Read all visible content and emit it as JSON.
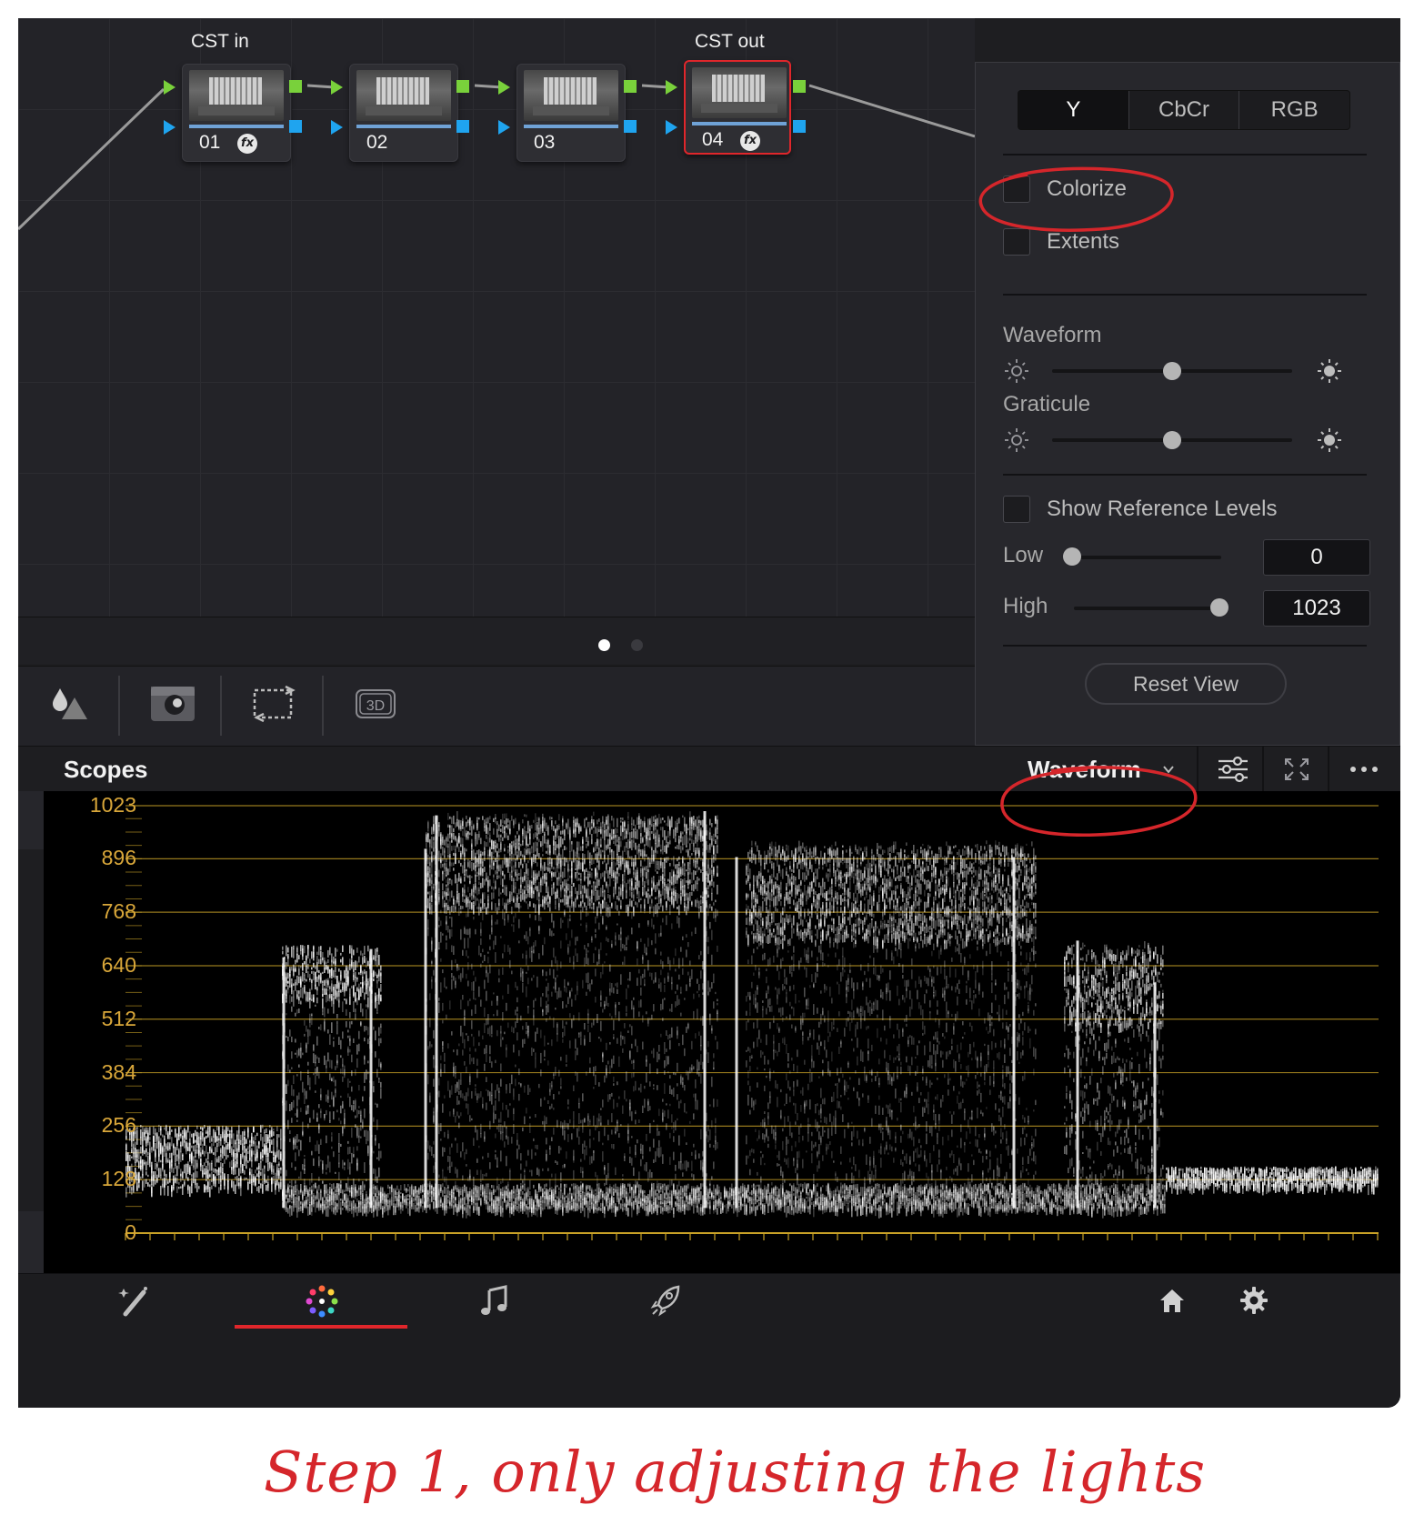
{
  "node_graph": {
    "labels": {
      "cst_in": "CST in",
      "cst_out": "CST out"
    },
    "nodes": [
      {
        "number": "01",
        "fx": true,
        "selected": false
      },
      {
        "number": "02",
        "fx": false,
        "selected": false
      },
      {
        "number": "03",
        "fx": false,
        "selected": false
      },
      {
        "number": "04",
        "fx": true,
        "selected": true
      }
    ],
    "fx_glyph": "fx",
    "page_index": {
      "current": 1,
      "total": 2
    }
  },
  "toolbar": {
    "icons": [
      "color-correction-icon",
      "key-mask-icon",
      "transform-icon",
      "3d-icon"
    ],
    "three_d_label": "3D"
  },
  "scope_settings": {
    "mode_tabs": [
      "Y",
      "CbCr",
      "RGB"
    ],
    "active_mode": "Y",
    "colorize_label": "Colorize",
    "colorize_checked": false,
    "extents_label": "Extents",
    "extents_checked": false,
    "waveform_label": "Waveform",
    "waveform_brightness": 0.5,
    "graticule_label": "Graticule",
    "graticule_brightness": 0.5,
    "show_reference_label": "Show Reference Levels",
    "show_reference_checked": false,
    "low_label": "Low",
    "low_value": "0",
    "high_label": "High",
    "high_value": "1023",
    "reset_label": "Reset View"
  },
  "scopes": {
    "title": "Scopes",
    "scope_type": "Waveform",
    "y_ticks": [
      "1023",
      "896",
      "768",
      "640",
      "512",
      "384",
      "256",
      "128",
      "0"
    ],
    "graticule_color": "#c9a227",
    "trace_color": "#ffffff"
  },
  "bottom_nav": {
    "items": [
      "edit-icon",
      "color-icon",
      "fairlight-icon",
      "deliver-icon",
      "home-icon",
      "settings-icon"
    ],
    "active": "color-icon",
    "active_color": "#e0262b"
  },
  "annotation": {
    "caption": "Step 1, only adjusting the lights",
    "color": "#d5262b"
  }
}
